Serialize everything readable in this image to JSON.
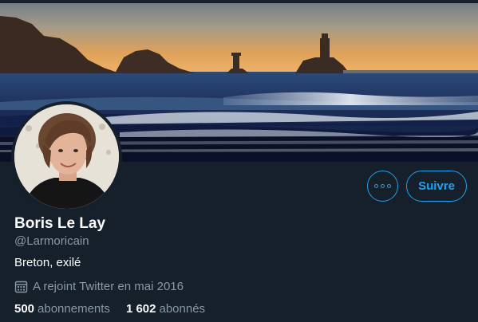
{
  "profile": {
    "display_name": "Boris Le Lay",
    "handle": "@Larmoricain",
    "bio": "Breton, exilé",
    "joined": "A rejoint Twitter en mai 2016",
    "following_count": "500",
    "following_label": "abonnements",
    "followers_count": "1 602",
    "followers_label": "abonnés"
  },
  "actions": {
    "follow_label": "Suivre",
    "more_icon": "more-options-icon"
  },
  "icons": {
    "joined": "calendar-icon"
  },
  "colors": {
    "background": "#15202b",
    "accent": "#1da1f2",
    "secondary_text": "#8899a6",
    "primary_text": "#ffffff"
  }
}
